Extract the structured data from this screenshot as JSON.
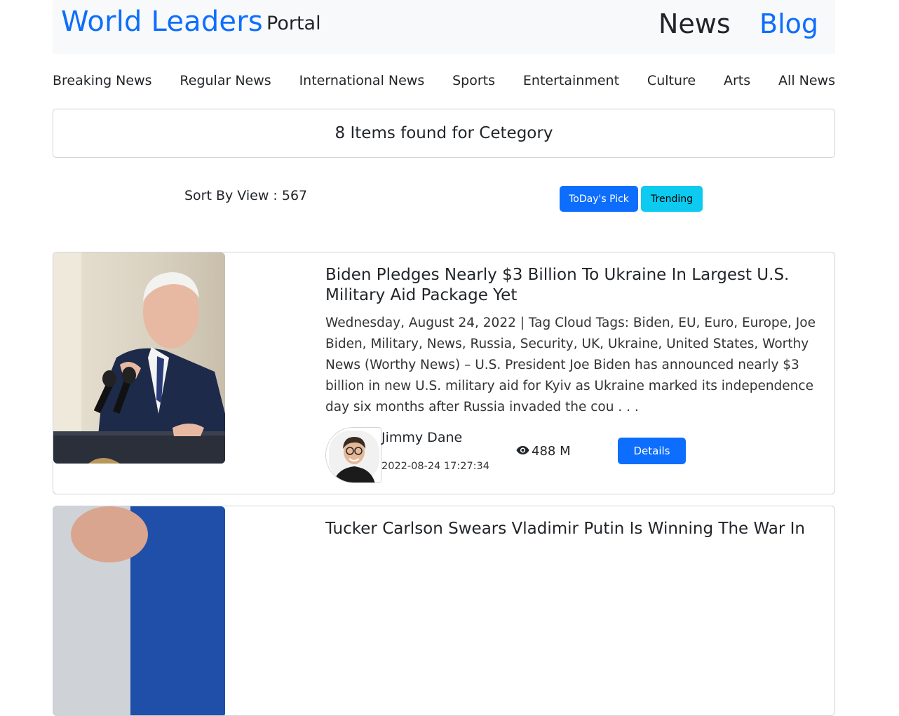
{
  "header": {
    "brand": "World Leaders",
    "portal": "Portal",
    "nav_news": "News",
    "nav_blog": "Blog"
  },
  "categories": [
    "Breaking News",
    "Regular News",
    "International News",
    "Sports",
    "Entertainment",
    "Culture",
    "Arts",
    "All News"
  ],
  "found_text": "8 Items found for Cetegory",
  "sort": {
    "label": "Sort By View : 567",
    "todays_pick": "ToDay's Pick",
    "trending": "Trending"
  },
  "articles": [
    {
      "title": "Biden Pledges Nearly $3 Billion To Ukraine In Largest U.S. Military Aid Package Yet",
      "excerpt": "Wednesday, August 24, 2022 | Tag Cloud Tags: Biden, EU, Euro, Europe, Joe Biden, Military, News, Russia, Security, UK, Ukraine, United States, Worthy News (Worthy News) – U.S. President Joe Biden has announced nearly $3 billion in new U.S. military aid for Kyiv as Ukraine marked its independence day six months after Russia invaded the cou . . .",
      "author": "Jimmy Dane",
      "date": "2022-08-24 17:27:34",
      "views": "488 M",
      "details_label": "Details"
    },
    {
      "title": "Tucker Carlson Swears Vladimir Putin Is Winning The War In"
    }
  ],
  "colors": {
    "primary": "#0d6efd",
    "info": "#0dcaf0",
    "navbar_bg": "#f8f9fa"
  },
  "icons": [
    "eye-icon"
  ]
}
